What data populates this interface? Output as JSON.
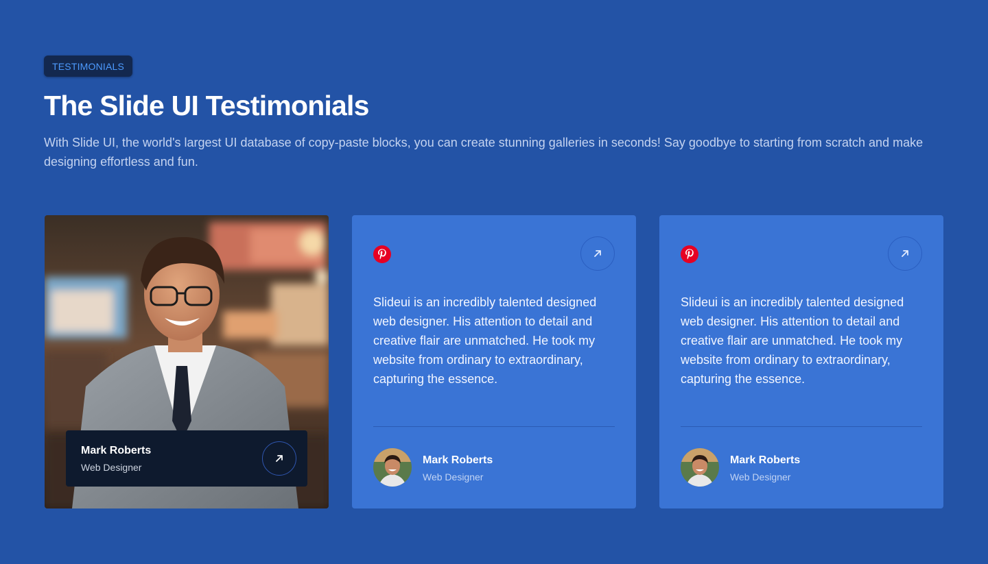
{
  "header": {
    "badge": "TESTIMONIALS",
    "title": "The Slide UI Testimonials",
    "subtitle": "With Slide UI, the world's largest UI database of copy-paste blocks, you can create stunning galleries in seconds! Say goodbye to starting from scratch and make designing effortless and fun."
  },
  "featured": {
    "name": "Mark Roberts",
    "role": "Web Designer",
    "icon": "arrow-up-right-icon"
  },
  "testimonials": [
    {
      "brand_icon": "pinterest-icon",
      "action_icon": "arrow-up-right-icon",
      "quote": "Slideui is an incredibly talented designed web designer. His attention to detail and creative flair are unmatched. He took my website from ordinary to extraordinary, capturing the essence.",
      "name": "Mark Roberts",
      "role": "Web Designer"
    },
    {
      "brand_icon": "pinterest-icon",
      "action_icon": "arrow-up-right-icon",
      "quote": "Slideui is an incredibly talented designed web designer. His attention to detail and creative flair are unmatched. He took my website from ordinary to extraordinary, capturing the essence.",
      "name": "Mark Roberts",
      "role": "Web Designer"
    }
  ],
  "colors": {
    "background": "#2353a6",
    "card": "#3a74d5",
    "badge_bg": "#13284f",
    "badge_text": "#4d9bff",
    "pinterest": "#e60023"
  }
}
